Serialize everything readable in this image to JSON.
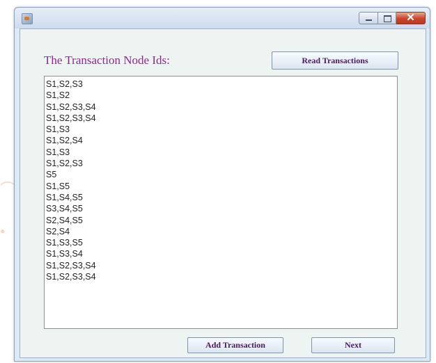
{
  "window": {
    "title": "",
    "controls": {
      "minimize": "–",
      "maximize": "□",
      "close": "✕"
    }
  },
  "main": {
    "label": "The Transaction Node Ids:",
    "read_button": "Read Transactions",
    "add_button": "Add Transaction",
    "next_button": "Next",
    "transactions": [
      "S1,S2,S3",
      "S1,S2",
      "S1,S2,S3,S4",
      "S1,S2,S3,S4",
      "S1,S3",
      "S1,S2,S4",
      "S1,S3",
      "S1,S2,S3",
      "S5",
      "S1,S5",
      "S1,S4,S5",
      "S3,S4,S5",
      "S2,S4,S5",
      "S2,S4",
      "S1,S3,S5",
      "S1,S3,S4",
      "S1,S2,S3,S4",
      "S1,S2,S3,S4"
    ]
  }
}
